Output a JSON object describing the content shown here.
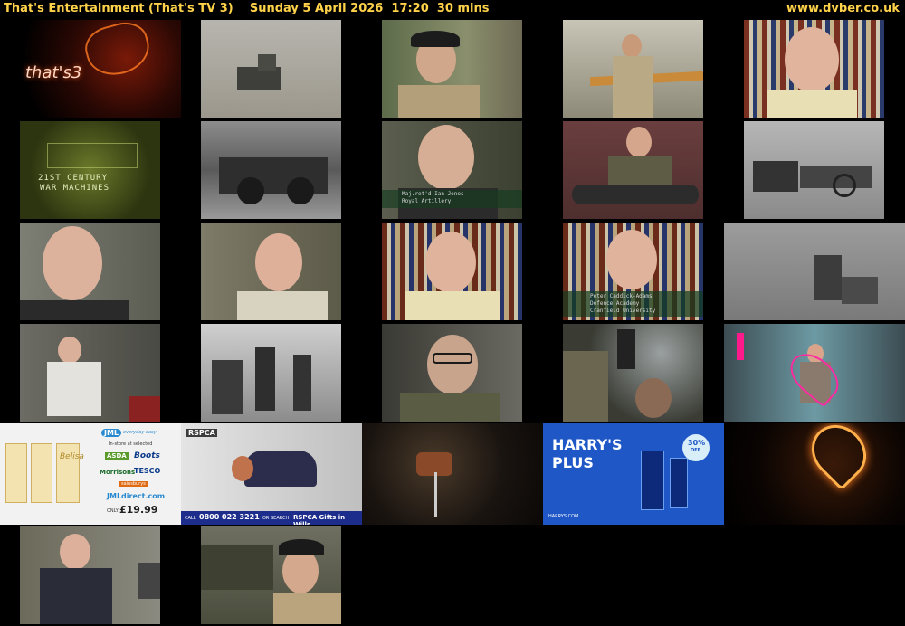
{
  "header": {
    "title": "That's Entertainment (That's TV 3)    Sunday 5 April 2026  17:20  30 mins",
    "site": "www.dvber.co.uk"
  },
  "channel_logo": "that's3",
  "intertitle": {
    "line1": "21st Century",
    "line2": "War Machines"
  },
  "caption_a": {
    "line1": "Maj.ret'd Ian Jones",
    "line2": "Royal Artillery"
  },
  "caption_b": {
    "line1": "Peter Caddick-Adams",
    "line2": "Defence Academy",
    "line3": "Cranfield University"
  },
  "ads": {
    "jml": {
      "brand": "JML",
      "tagline": "everyday easy",
      "instore": "In-store at selected",
      "stores": [
        "ASDA",
        "Boots",
        "Morrisons",
        "TESCO",
        "sainsburys"
      ],
      "url": "JMLdirect.com",
      "price_prefix": "ONLY",
      "price": "£19.99",
      "product": "Belisa"
    },
    "rspca": {
      "logo": "RSPCA",
      "call_label": "CALL",
      "phone": "0800 022 3221",
      "or": "OR SEARCH",
      "action": "RSPCA Gifts in Wills"
    },
    "harrys": {
      "line1": "HARRY'S",
      "line2": "PLUS",
      "badge_pct": "30%",
      "badge_sub": "OFF",
      "url": "HARRYS.COM"
    }
  },
  "colors": {
    "header_text": "#ffd24a",
    "background": "#000000",
    "harrys_blue": "#1f57c6",
    "rspca_bar": "#1d2d8c"
  },
  "thumbnails": [
    {
      "row": 0,
      "col": 0,
      "desc": "channel-ident"
    },
    {
      "row": 0,
      "col": 1,
      "desc": "desert-rocket-launcher"
    },
    {
      "row": 0,
      "col": 2,
      "desc": "soldier-interview"
    },
    {
      "row": 0,
      "col": 3,
      "desc": "soldier-gun-barrel"
    },
    {
      "row": 0,
      "col": 4,
      "desc": "presenter-bookshelf"
    },
    {
      "row": 1,
      "col": 0,
      "desc": "intertitle"
    },
    {
      "row": 1,
      "col": 1,
      "desc": "archive-vehicle"
    },
    {
      "row": 1,
      "col": 2,
      "desc": "veteran-interview"
    },
    {
      "row": 1,
      "col": 3,
      "desc": "soldier-with-barrel"
    },
    {
      "row": 1,
      "col": 4,
      "desc": "archive-horses"
    },
    {
      "row": 2,
      "col": 0,
      "desc": "veteran-closeup"
    },
    {
      "row": 2,
      "col": 1,
      "desc": "presenter-artillery"
    },
    {
      "row": 2,
      "col": 2,
      "desc": "presenter-bookshelf"
    },
    {
      "row": 2,
      "col": 3,
      "desc": "presenter-caption"
    },
    {
      "row": 2,
      "col": 4,
      "desc": "archive-gun-crew"
    },
    {
      "row": 3,
      "col": 0,
      "desc": "presenter-standing"
    },
    {
      "row": 3,
      "col": 1,
      "desc": "archive-soldiers"
    },
    {
      "row": 3,
      "col": 2,
      "desc": "soldier-glasses"
    },
    {
      "row": 3,
      "col": 3,
      "desc": "soldier-in-tank"
    },
    {
      "row": 3,
      "col": 4,
      "desc": "ident-woman"
    },
    {
      "row": 4,
      "col": 0,
      "desc": "ad-jml"
    },
    {
      "row": 4,
      "col": 1,
      "desc": "ad-rspca"
    },
    {
      "row": 4,
      "col": 2,
      "desc": "ad-food"
    },
    {
      "row": 4,
      "col": 3,
      "desc": "ad-harrys"
    },
    {
      "row": 4,
      "col": 4,
      "desc": "ident-heart"
    },
    {
      "row": 5,
      "col": 0,
      "desc": "veteran-standing"
    },
    {
      "row": 5,
      "col": 1,
      "desc": "soldier-beret"
    }
  ]
}
